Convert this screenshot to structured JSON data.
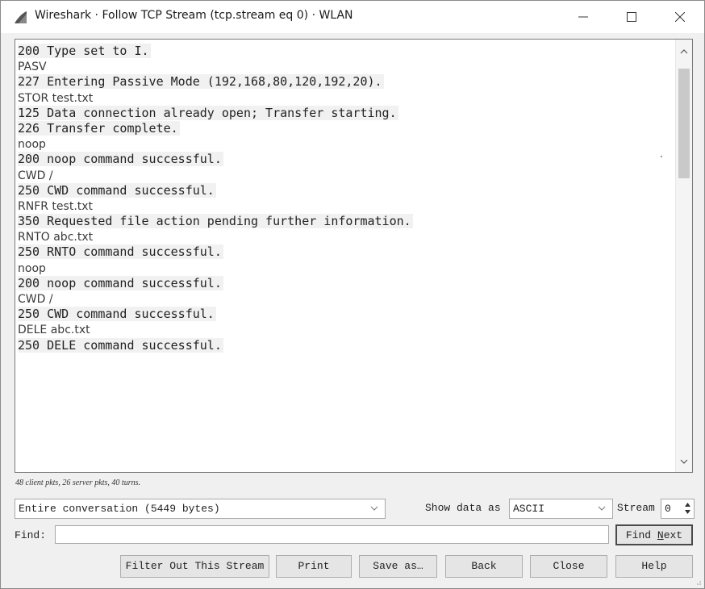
{
  "window": {
    "title": "Wireshark · Follow TCP Stream (tcp.stream eq 0) · WLAN"
  },
  "stream": {
    "lines": [
      {
        "text": "200 Type set to I.",
        "dir": "server"
      },
      {
        "text": "PASV",
        "dir": "client"
      },
      {
        "text": "227 Entering Passive Mode (192,168,80,120,192,20).",
        "dir": "server"
      },
      {
        "text": "STOR test.txt",
        "dir": "client"
      },
      {
        "text": "125 Data connection already open; Transfer starting.",
        "dir": "server"
      },
      {
        "text": "226 Transfer complete.",
        "dir": "server"
      },
      {
        "text": "noop",
        "dir": "client"
      },
      {
        "text": "200 noop command successful.",
        "dir": "server"
      },
      {
        "text": "CWD /",
        "dir": "client"
      },
      {
        "text": "250 CWD command successful.",
        "dir": "server"
      },
      {
        "text": "RNFR test.txt",
        "dir": "client"
      },
      {
        "text": "350 Requested file action pending further information.",
        "dir": "server"
      },
      {
        "text": "RNTO abc.txt",
        "dir": "client"
      },
      {
        "text": "250 RNTO command successful.",
        "dir": "server"
      },
      {
        "text": "noop",
        "dir": "client"
      },
      {
        "text": "200 noop command successful.",
        "dir": "server"
      },
      {
        "text": "CWD /",
        "dir": "client"
      },
      {
        "text": "250 CWD command successful.",
        "dir": "server"
      },
      {
        "text": "DELE abc.txt",
        "dir": "client"
      },
      {
        "text": "250 DELE command successful.",
        "dir": "server"
      }
    ]
  },
  "stats": "48 client pkts, 26 server pkts, 40 turns.",
  "conversation": {
    "selected": "Entire conversation (5449 bytes)"
  },
  "show_data": {
    "label": "Show data as",
    "selected": "ASCII"
  },
  "stream_num": {
    "label": "Stream",
    "value": "0"
  },
  "find": {
    "label": "Find:",
    "value": ""
  },
  "buttons": {
    "find_next_pre": "Find ",
    "find_next_key": "N",
    "find_next_post": "ext",
    "filter_out": "Filter Out This Stream",
    "print": "Print",
    "save_as": "Save as…",
    "back": "Back",
    "close": "Close",
    "help": "Help"
  },
  "colors": {
    "server_bg": "#f1f1f1",
    "titlebar_bg": "#ffffff",
    "dialog_bg": "#f0f0f0",
    "scroll_thumb": "#c9c9c9"
  },
  "icons": [
    "wireshark-fin-icon",
    "minimize-icon",
    "maximize-icon",
    "close-icon",
    "scroll-up-arrow-icon",
    "scroll-down-arrow-icon",
    "dropdown-caret-icon",
    "spin-arrows-icon",
    "resize-grip-icon"
  ]
}
